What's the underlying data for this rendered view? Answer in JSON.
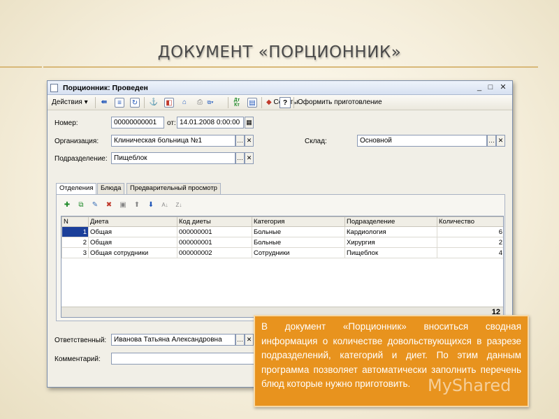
{
  "slide": {
    "title": "ДОКУМЕНТ «ПОРЦИОННИК»"
  },
  "window": {
    "title": "Порционник: Проведен",
    "controls": [
      "_",
      "□",
      "✕"
    ]
  },
  "toolbar": {
    "actions_label": "Действия",
    "advice_label": "Советы",
    "help_label": "?",
    "prepare_label": "Оформить приготовление"
  },
  "form": {
    "number_label": "Номер:",
    "number_value": "00000000001",
    "date_label": "от:",
    "date_value": "14.01.2008  0:00:00",
    "org_label": "Организация:",
    "org_value": "Клиническая больница №1",
    "warehouse_label": "Склад:",
    "warehouse_value": "Основной",
    "dept_label": "Подразделение:",
    "dept_value": "Пищеблок",
    "responsible_label": "Ответственный:",
    "responsible_value": "Иванова Татьяна Александровна",
    "comment_label": "Комментарий:",
    "comment_value": ""
  },
  "tabs": [
    {
      "label": "Отделения",
      "active": true
    },
    {
      "label": "Блюда",
      "active": false
    },
    {
      "label": "Предварительный просмотр",
      "active": false
    }
  ],
  "grid": {
    "columns": [
      "N",
      "Диета",
      "Код диеты",
      "Категория",
      "Подразделение",
      "Количество"
    ],
    "rows": [
      [
        "1",
        "Общая",
        "000000001",
        "Больные",
        "Кардиология",
        "6"
      ],
      [
        "2",
        "Общая",
        "000000001",
        "Больные",
        "Хирургия",
        "2"
      ],
      [
        "3",
        "Общая сотрудники",
        "000000002",
        "Сотрудники",
        "Пищеблок",
        "4"
      ]
    ],
    "total": "12"
  },
  "callout": {
    "text": "В документ «Порционник» вноситься сводная информация о количестве довольствующихся в разрезе подразделений, категорий и диет. По этим данным программа позволяет автоматически заполнить перечень блюд которые нужно приготовить."
  },
  "watermark": "MyShared",
  "colors": {
    "callout_bg": "#e8931e",
    "selection": "#1b3f9a"
  }
}
